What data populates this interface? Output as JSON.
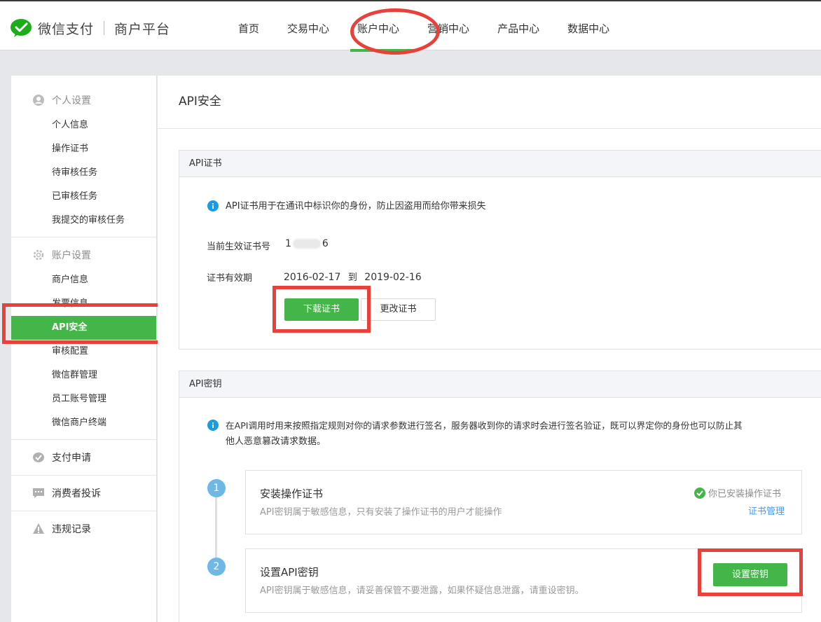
{
  "header": {
    "brand": "微信支付",
    "platform": "商户平台",
    "nav": [
      "首页",
      "交易中心",
      "账户中心",
      "营销中心",
      "产品中心",
      "数据中心"
    ],
    "active_nav": 2
  },
  "sidebar": {
    "sections": [
      {
        "title": "个人设置",
        "icon": "user-icon",
        "items": [
          "个人信息",
          "操作证书",
          "待审核任务",
          "已审核任务",
          "我提交的审核任务"
        ]
      },
      {
        "title": "账户设置",
        "icon": "gear-icon",
        "items": [
          "商户信息",
          "发票信息",
          "API安全",
          "审核配置",
          "微信群管理",
          "员工账号管理",
          "微信商户终端"
        ]
      },
      {
        "title": "支付申请",
        "icon": "check-badge-icon",
        "items": []
      },
      {
        "title": "消费者投诉",
        "icon": "chat-icon",
        "items": []
      },
      {
        "title": "违规记录",
        "icon": "warning-icon",
        "items": []
      }
    ],
    "active_item": "API安全"
  },
  "main": {
    "title": "API安全",
    "cert": {
      "section_title": "API证书",
      "info": "API证书用于在通讯中标识你的身份，防止因盗用而给你带来损失",
      "cert_no_label": "当前生效证书号",
      "cert_no_prefix": "1",
      "cert_no_suffix": "6",
      "validity_label": "证书有效期",
      "valid_from": "2016-02-17",
      "to_word": "到",
      "valid_to": "2019-02-16",
      "download_btn": "下载证书",
      "change_btn": "更改证书"
    },
    "key": {
      "section_title": "API密钥",
      "info_line1": "在API调用时用来按照指定规则对你的请求参数进行签名，服务器收到你的请求时会进行签名验证，既可以界定你的身份也可以防止其",
      "info_line2": "他人恶意篡改请求数据。",
      "steps": [
        {
          "num": "1",
          "title": "安装操作证书",
          "desc": "API密钥属于敏感信息，只有安装了操作证书的用户才能操作",
          "status": "你已安装操作证书",
          "link": "证书管理"
        },
        {
          "num": "2",
          "title": "设置API密钥",
          "desc": "API密钥属于敏感信息，请妥善保管不要泄露，如果怀疑信息泄露，请重设密钥。",
          "button": "设置密钥"
        }
      ]
    }
  },
  "colors": {
    "accent": "#44b549",
    "annotation": "#e8413c",
    "step": "#6eb8e6",
    "link": "#459ae9",
    "info": "#1a9be6"
  }
}
